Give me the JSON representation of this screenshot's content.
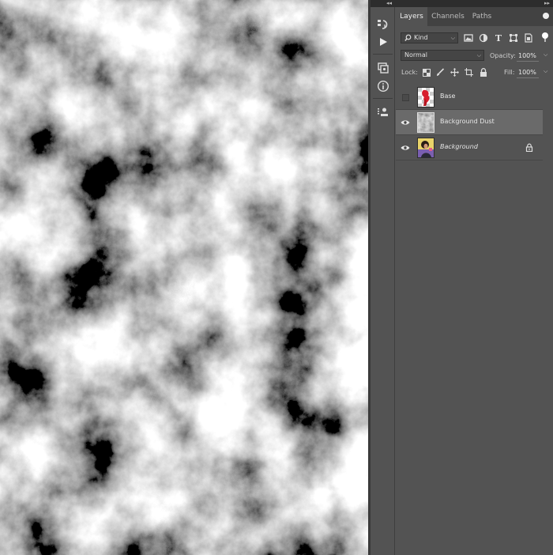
{
  "panel": {
    "tabs": [
      {
        "label": "Layers",
        "active": true
      },
      {
        "label": "Channels",
        "active": false
      },
      {
        "label": "Paths",
        "active": false
      }
    ],
    "filter": {
      "value": "Kind"
    },
    "blend_mode": {
      "value": "Normal"
    },
    "opacity": {
      "label": "Opacity:",
      "value": "100%"
    },
    "lock": {
      "label": "Lock:"
    },
    "fill": {
      "label": "Fill:",
      "value": "100%"
    },
    "layers": [
      {
        "name": "Base",
        "visible": false,
        "selected": false,
        "italic": false,
        "locked": false
      },
      {
        "name": "Background Dust",
        "visible": true,
        "selected": true,
        "italic": false,
        "locked": false
      },
      {
        "name": "Background",
        "visible": true,
        "selected": false,
        "italic": true,
        "locked": true
      }
    ]
  },
  "icons": {
    "toolstrip": [
      "history-icon",
      "play-actions-icon",
      "device-preview-icon",
      "info-icon",
      "properties-icon"
    ],
    "filters": [
      "image-filter-icon",
      "adjustment-filter-icon",
      "type-filter-icon",
      "shape-filter-icon",
      "smart-object-filter-icon"
    ],
    "locks": [
      "lock-transparent-icon",
      "lock-pixels-icon",
      "lock-position-icon",
      "lock-artboard-icon",
      "lock-all-icon"
    ]
  },
  "colors": {
    "workspace": "#535353",
    "tab_bar": "#424242",
    "selected_layer": "#6a6a6a"
  }
}
